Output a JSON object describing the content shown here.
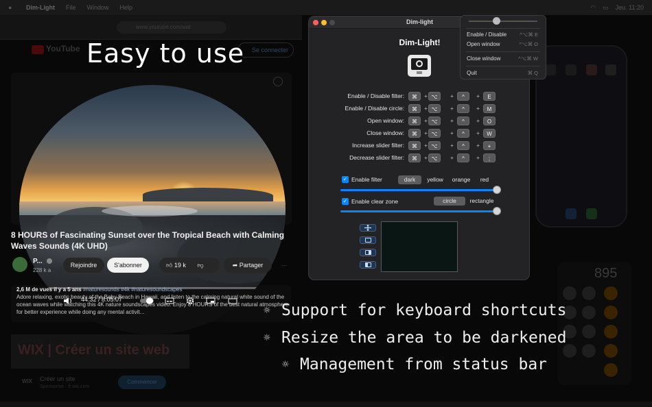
{
  "menubar": {
    "app_name": "Dim-Light",
    "items": [
      "File",
      "Window",
      "Help"
    ],
    "clock": "Jeu. 11:20"
  },
  "browser": {
    "url": "www.youtube.com/wat"
  },
  "youtube": {
    "logo_text": "YouTube",
    "signin_label": "Se connecter",
    "video": {
      "timecode": "44:32 / 8:05:07",
      "progress_fraction": 0.08,
      "title": "8 HOURS of Fascinating Sunset over the Tropical Beach with Calming Waves Sounds (4K UHD)",
      "channel_name": "P...",
      "subscribers": "228 k a",
      "join_label": "Rejoindre",
      "subscribe_label": "S'abonner",
      "likes": "19 k",
      "share_label": "Partager",
      "meta": "2,6 M de vues  il y a 5 ans",
      "tags": "#naturesounds #4k #naturesoundscapes",
      "description": "Adore relaxing, exotic beauty of the Baby Beach in Hawaii, and listen to the calming natural white sound of the ocean waves while watching this 4K nature soundscapes video. Enjoy 8 HOURS of the best natural atmosphere for better experience while doing any mental activit..."
    },
    "ad": {
      "banner": "WIX | Créer un site web",
      "brand": "WIX",
      "title": "Créer un site",
      "sponsor": "Sponsorisé · fr.wix.com",
      "cta": "Commencer"
    }
  },
  "calculator": {
    "display": "895"
  },
  "headline": "Easy to use",
  "features": [
    "Support for keyboard shortcuts",
    "Resize the area to be darkened",
    "Management from status bar"
  ],
  "window": {
    "title": "Dim-light",
    "heading": "Dim-Light!",
    "shortcuts": [
      {
        "label": "Enable / Disable filter:",
        "keys": [
          "⌘",
          "⌥",
          "^",
          "E"
        ]
      },
      {
        "label": "Enable / Disable circle:",
        "keys": [
          "⌘",
          "⌥",
          "^",
          "M"
        ]
      },
      {
        "label": "Open window:",
        "keys": [
          "⌘",
          "⌥",
          "^",
          "O"
        ]
      },
      {
        "label": "Close window:",
        "keys": [
          "⌘",
          "⌥",
          "^",
          "W"
        ]
      },
      {
        "label": "Increase slider filter:",
        "keys": [
          "⌘",
          "⌥",
          "^",
          "+"
        ]
      },
      {
        "label": "Decrease slider filter:",
        "keys": [
          "⌘",
          "⌥",
          "^",
          ";"
        ]
      }
    ],
    "plus_sign": "+",
    "enable_filter_label": "Enable filter",
    "filter_options": [
      "dark",
      "yellow",
      "orange",
      "red"
    ],
    "filter_selected": "dark",
    "filter_level": 1.0,
    "enable_clear_zone_label": "Enable clear zone",
    "zone_options": [
      "circle",
      "rectangle"
    ],
    "zone_selected": "circle",
    "zone_level": 1.0,
    "zone_buttons": [
      "move-icon",
      "center-zone-icon",
      "right-half-icon",
      "left-half-icon"
    ]
  },
  "status_menu": {
    "brightness_level": 0.4,
    "items": [
      {
        "label": "Enable / Disable",
        "shortcut": "^⌥⌘ E"
      },
      {
        "label": "Open window",
        "shortcut": "^⌥⌘ O"
      },
      {
        "label": "Close window",
        "shortcut": "^⌥⌘ W"
      },
      {
        "label": "Quit",
        "shortcut": "⌘ Q"
      }
    ]
  }
}
